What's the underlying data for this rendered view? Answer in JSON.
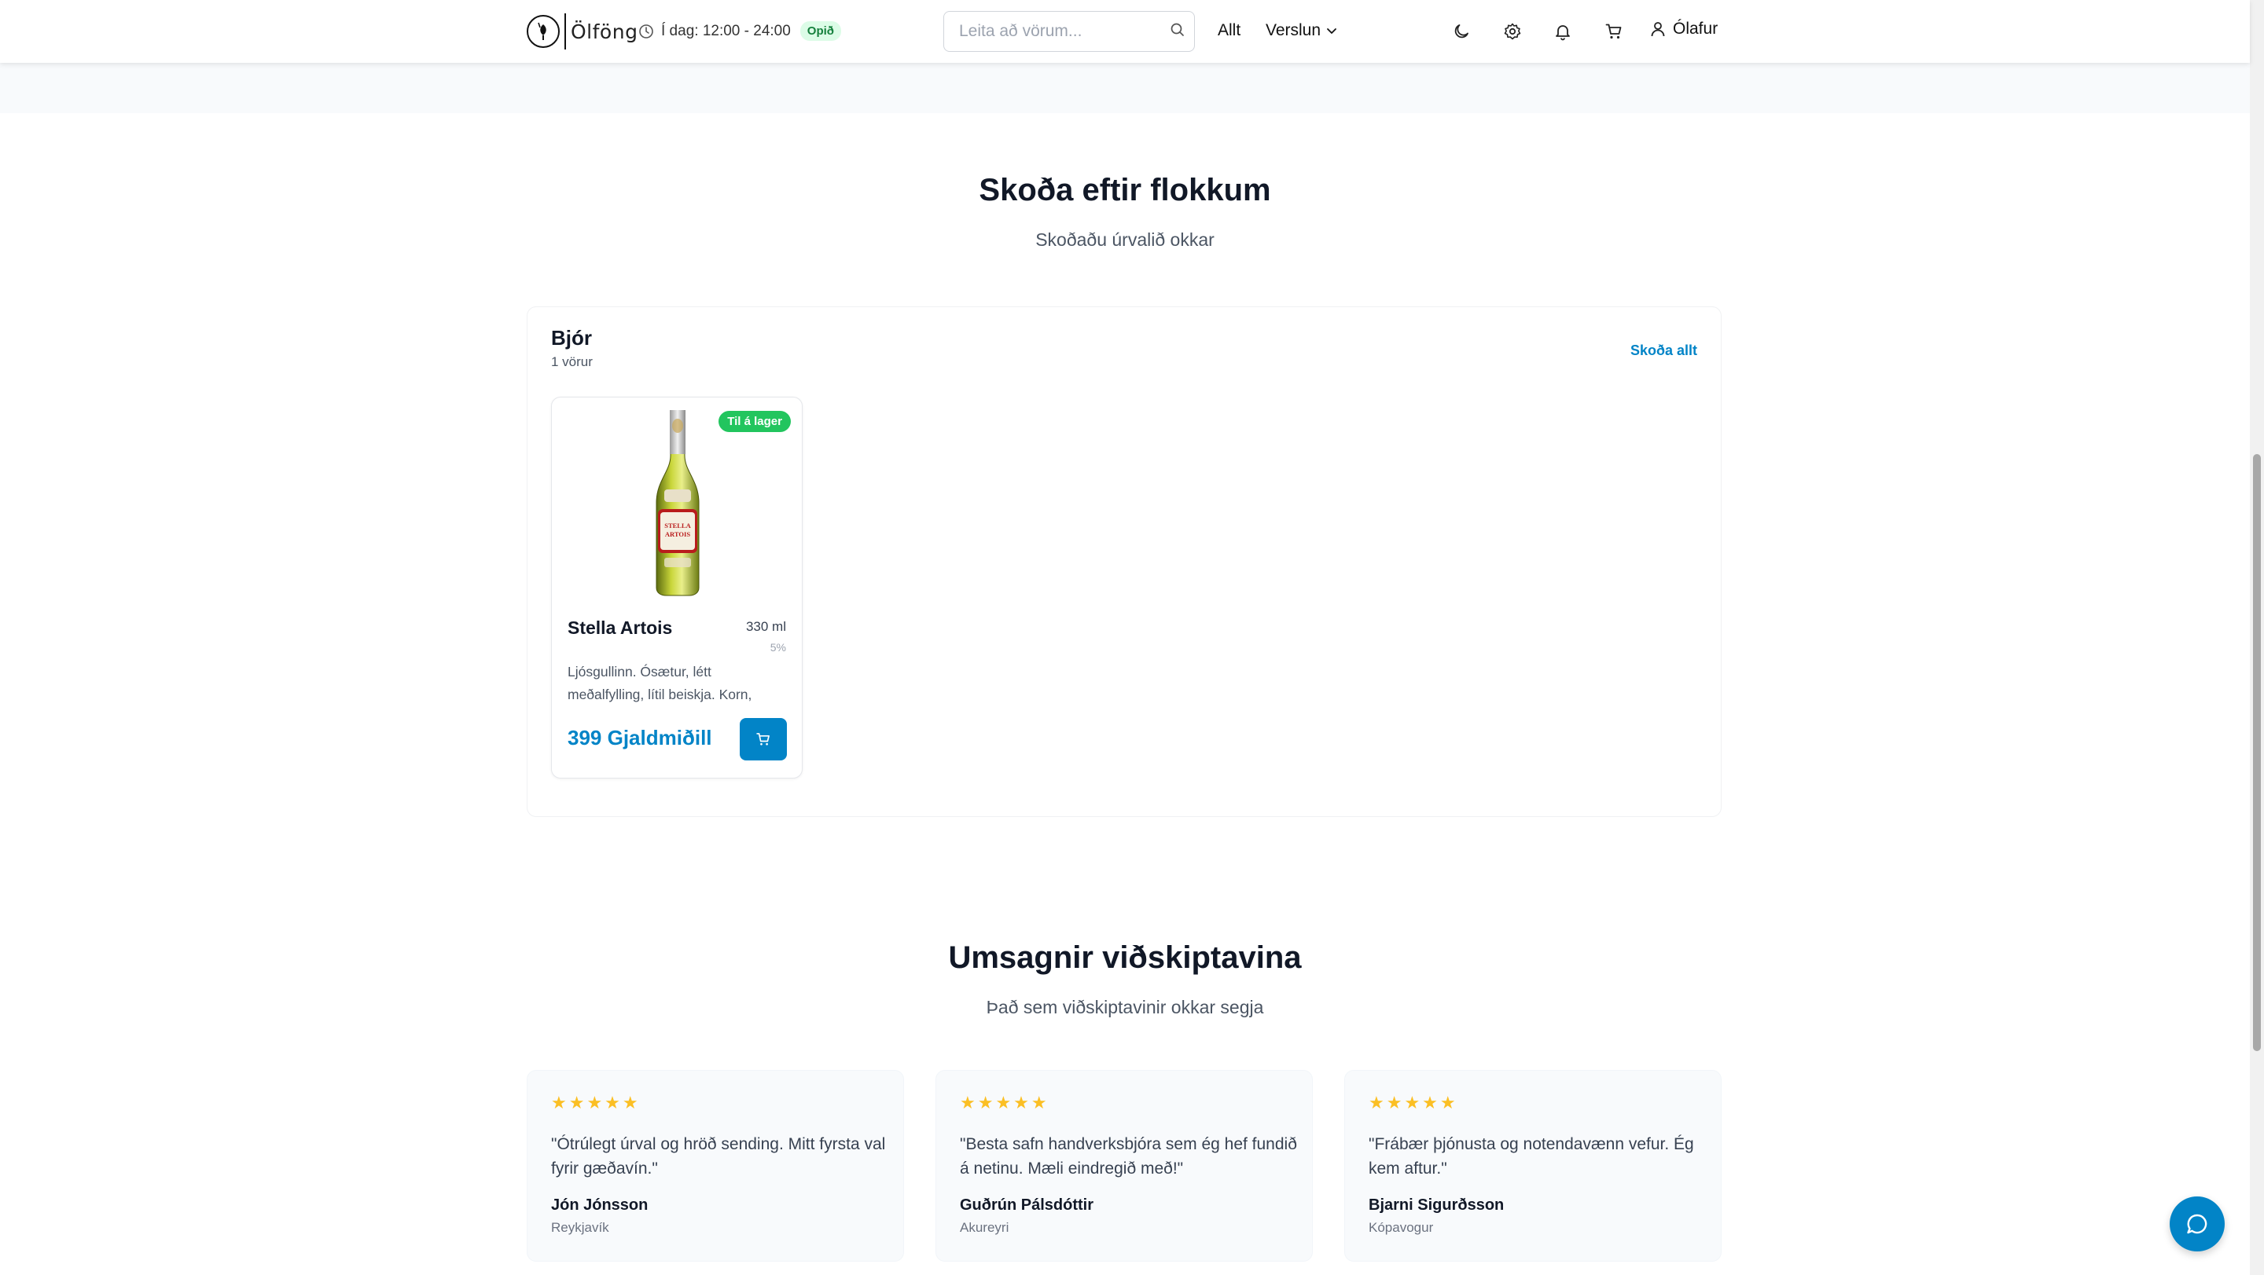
{
  "header": {
    "logo_text": "Ölföng",
    "hours_text": "Í dag: 12:00 - 24:00",
    "open_badge": "Opið",
    "search_placeholder": "Leita að vörum...",
    "nav_all": "Allt",
    "nav_store": "Verslun",
    "user_name": "Ólafur"
  },
  "categories_section": {
    "title": "Skoða eftir flokkum",
    "subtitle": "Skoðaðu úrvalið okkar"
  },
  "category": {
    "name": "Bjór",
    "count": "1 vörur",
    "view_all": "Skoða allt"
  },
  "product": {
    "badge": "Til á lager",
    "name": "Stella Artois",
    "volume": "330 ml",
    "abv": "5%",
    "label_line1": "STELLA",
    "label_line2": "ARTOIS",
    "description": "Ljósgullinn. Ósætur, létt meðalfylling, lítil beiskja. Korn, humlar.",
    "price": "399 Gjaldmiðill"
  },
  "testimonials_section": {
    "title": "Umsagnir viðskiptavina",
    "subtitle": "Það sem viðskiptavinir okkar segja"
  },
  "testimonials": [
    {
      "stars": "★★★★★",
      "quote": "\"Ótrúlegt úrval og hröð sending. Mitt fyrsta val fyrir gæðavín.\"",
      "name": "Jón Jónsson",
      "city": "Reykjavík"
    },
    {
      "stars": "★★★★★",
      "quote": "\"Besta safn handverksbjóra sem ég hef fundið á netinu. Mæli eindregið með!\"",
      "name": "Guðrún Pálsdóttir",
      "city": "Akureyri"
    },
    {
      "stars": "★★★★★",
      "quote": "\"Frábær þjónusta og notendavænn vefur. Ég kem aftur.\"",
      "name": "Bjarni Sigurðsson",
      "city": "Kópavogur"
    }
  ],
  "colors": {
    "accent": "#0284c7",
    "success": "#22c55e",
    "star": "#fbbf24"
  }
}
